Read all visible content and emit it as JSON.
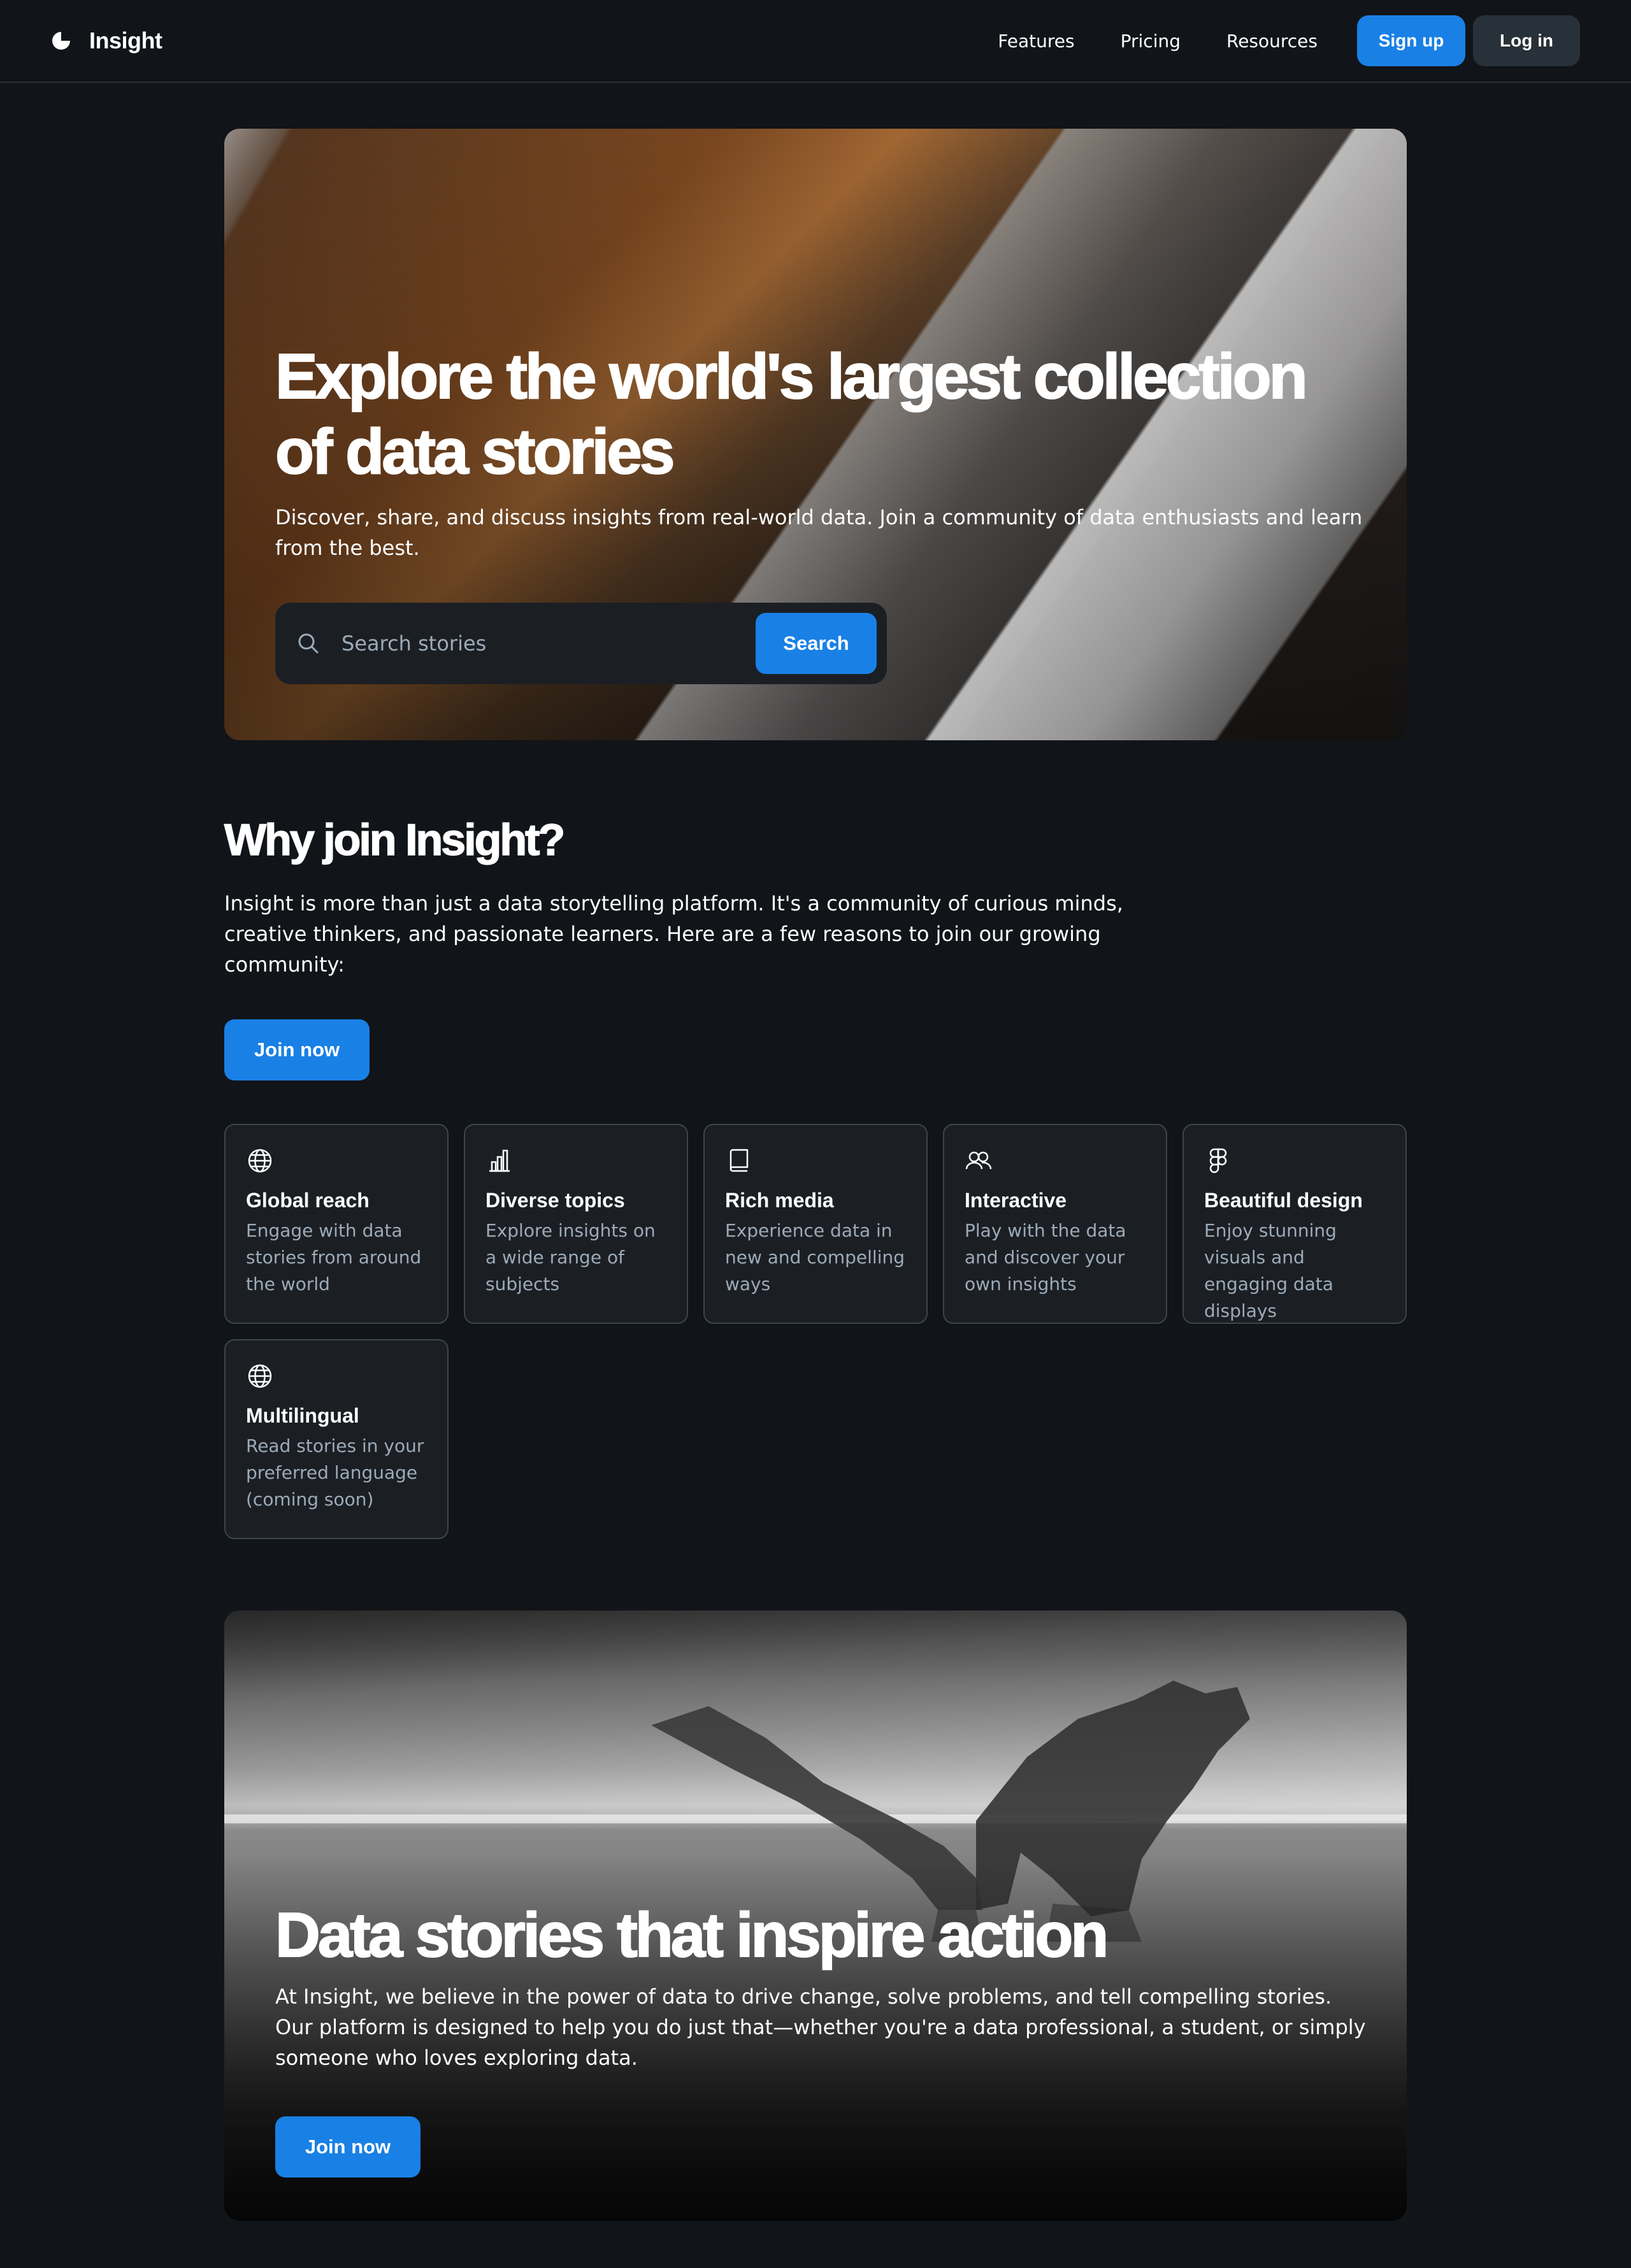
{
  "header": {
    "brand": "Insight",
    "nav": [
      "Features",
      "Pricing",
      "Resources"
    ],
    "signup_label": "Sign up",
    "login_label": "Log in"
  },
  "hero": {
    "title": "Explore the world's largest collection of data stories",
    "subtitle": "Discover, share, and discuss insights from real-world data. Join a community of data enthusiasts and learn from the best.",
    "search_placeholder": "Search stories",
    "search_button": "Search"
  },
  "why": {
    "title": "Why join Insight?",
    "text": "Insight is more than just a data storytelling platform. It's a community of curious minds, creative thinkers, and passionate learners. Here are a few reasons to join our growing community:",
    "join_label": "Join now",
    "features": [
      {
        "icon": "globe-icon",
        "title": "Global reach",
        "desc": "Engage with data stories from around the world"
      },
      {
        "icon": "bar-chart-icon",
        "title": "Diverse topics",
        "desc": "Explore insights on a wide range of subjects"
      },
      {
        "icon": "book-icon",
        "title": "Rich media",
        "desc": "Experience data in new and compelling ways"
      },
      {
        "icon": "users-icon",
        "title": "Interactive",
        "desc": "Play with the data and discover your own insights"
      },
      {
        "icon": "figma-icon",
        "title": "Beautiful design",
        "desc": "Enjoy stunning visuals and engaging data displays"
      },
      {
        "icon": "globe-icon",
        "title": "Multilingual",
        "desc": "Read stories in your preferred language (coming soon)"
      }
    ]
  },
  "inspire": {
    "title": "Data stories that inspire action",
    "text": "At Insight, we believe in the power of data to drive change, solve problems, and tell compelling stories. Our platform is designed to help you do just that—whether you're a data professional, a student, or simply someone who loves exploring data.",
    "join_label": "Join now"
  },
  "colors": {
    "background": "#111418",
    "accent": "#1980e6",
    "card": "#1b1f24",
    "muted_text": "#9daab8"
  }
}
